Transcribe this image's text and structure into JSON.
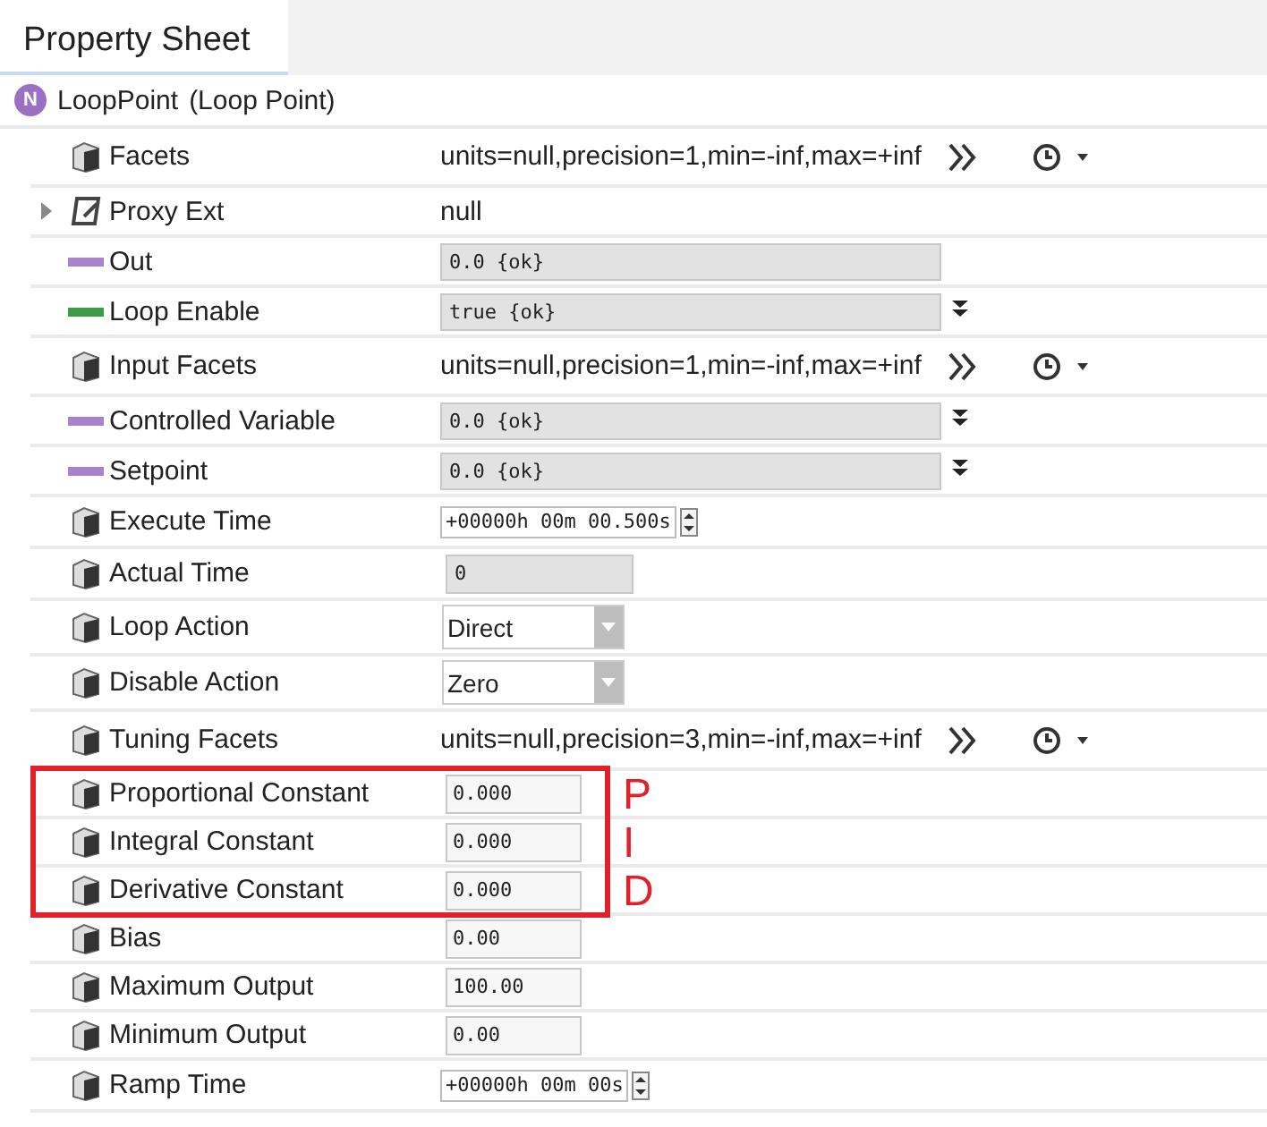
{
  "tab": {
    "label": "Property Sheet",
    "selected": true
  },
  "component": {
    "badge": "N",
    "name": "LoopPoint",
    "type": "(Loop Point)"
  },
  "rows": [
    {
      "kind": "facets",
      "label": "Facets",
      "value": "units=null,precision=1,min=-inf,max=+inf"
    },
    {
      "kind": "text",
      "label": "Proxy Ext",
      "value": "null",
      "expanded": false
    },
    {
      "kind": "status",
      "color": "#a883c9",
      "label": "Out",
      "value": "0.0 {ok}",
      "menu": false
    },
    {
      "kind": "status",
      "color": "#3f9a48",
      "label": "Loop Enable",
      "value": "true {ok}",
      "menu": true
    },
    {
      "kind": "facets",
      "label": "Input Facets",
      "value": "units=null,precision=1,min=-inf,max=+inf"
    },
    {
      "kind": "status",
      "color": "#a883c9",
      "label": "Controlled Variable",
      "value": "0.0 {ok}",
      "menu": true
    },
    {
      "kind": "status",
      "color": "#a883c9",
      "label": "Setpoint",
      "value": "0.0 {ok}",
      "menu": true
    },
    {
      "kind": "time",
      "label": "Execute Time",
      "value": "+00000h 00m 00.500s"
    },
    {
      "kind": "readonly",
      "label": "Actual Time",
      "value": "0"
    },
    {
      "kind": "select",
      "label": "Loop Action",
      "value": "Direct"
    },
    {
      "kind": "select",
      "label": "Disable Action",
      "value": "Zero"
    },
    {
      "kind": "facets",
      "label": "Tuning Facets",
      "value": "units=null,precision=3,min=-inf,max=+inf"
    },
    {
      "kind": "number",
      "label": "Proportional Constant",
      "value": "0.000",
      "annotation": "P"
    },
    {
      "kind": "number",
      "label": "Integral Constant",
      "value": "0.000",
      "annotation": "I"
    },
    {
      "kind": "number",
      "label": "Derivative Constant",
      "value": "0.000",
      "annotation": "D"
    },
    {
      "kind": "number",
      "label": "Bias",
      "value": "0.00"
    },
    {
      "kind": "number",
      "label": "Maximum Output",
      "value": "100.00"
    },
    {
      "kind": "number",
      "label": "Minimum Output",
      "value": "0.00"
    },
    {
      "kind": "time",
      "label": "Ramp Time",
      "value": "+00000h 00m 00s"
    }
  ]
}
